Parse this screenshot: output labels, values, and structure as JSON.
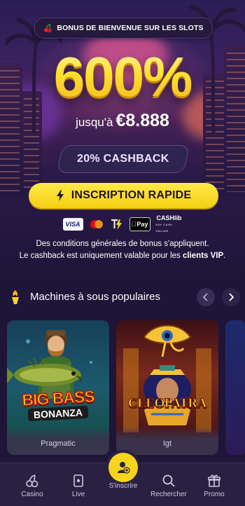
{
  "promo": {
    "banner_text": "BONUS DE BIENVENUE SUR LES SLOTS",
    "percentage": "600%",
    "upto_prefix": "jusqu'à",
    "upto_amount": "€8.888",
    "cashback_label": "20% CASHBACK",
    "cta_label": "INSCRIPTION RAPIDE",
    "terms_line1": "Des conditions générales de bonus s'appliquent.",
    "terms_line2_prefix": "Le cashback est uniquement valable pour les",
    "terms_line2_bold": "clients VIP",
    "terms_line2_suffix": "."
  },
  "payments": [
    {
      "name": "visa",
      "label": "VISA"
    },
    {
      "name": "mastercard",
      "label": ""
    },
    {
      "name": "tether-bolt",
      "label": ""
    },
    {
      "name": "apple-pay",
      "label": "Pay"
    },
    {
      "name": "cashlib",
      "label": "CASHlib",
      "sub": "PAY CASH ONLINE"
    }
  ],
  "section": {
    "title": "Machines à sous populaires",
    "prev_icon": "chevron-left-icon",
    "next_icon": "chevron-right-icon"
  },
  "games": [
    {
      "title_art": "BIG BASS",
      "subtitle_art": "BONANZA",
      "provider": "Pragmatic"
    },
    {
      "title_art": "CLEOPATRA",
      "provider": "Igt"
    }
  ],
  "nav": {
    "casino": "Casino",
    "live": "Live",
    "signup": "S'inscrire",
    "search": "Rechercher",
    "promo": "Promo"
  },
  "colors": {
    "accent_yellow": "#f7d51d",
    "background": "#1e1538",
    "nav_background": "#2a2142"
  }
}
